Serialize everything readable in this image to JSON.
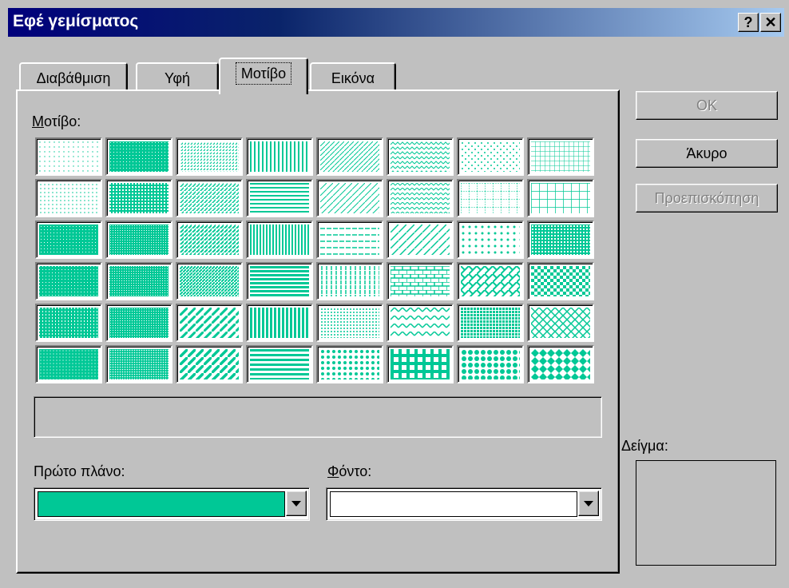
{
  "window": {
    "title": "Εφέ γεμίσματος",
    "help_label": "?",
    "close_label": "✕"
  },
  "tabs": [
    {
      "label": "Διαβάθμιση",
      "active": false
    },
    {
      "label": "Υφή",
      "active": false
    },
    {
      "label": "Μοτίβο",
      "active": true
    },
    {
      "label": "Εικόνα",
      "active": false
    }
  ],
  "pattern_section": {
    "label": "Μοτίβο:",
    "rows": 6,
    "cols": 8,
    "selected_name": ""
  },
  "foreground": {
    "label": "Πρώτο πλάνο:",
    "color": "#00c896"
  },
  "background": {
    "label": "Φόντο:",
    "color": "#ffffff"
  },
  "buttons": {
    "ok": "ΟΚ",
    "cancel": "Άκυρο",
    "preview": "Προεπισκόπηση"
  },
  "sample": {
    "label": "Δείγμα:"
  },
  "colors": {
    "dialog_bg": "#c0c0c0",
    "title_start": "#00007b",
    "title_end": "#a6caf0",
    "pattern_fg": "#00c896",
    "pattern_bg": "#ffffff"
  }
}
